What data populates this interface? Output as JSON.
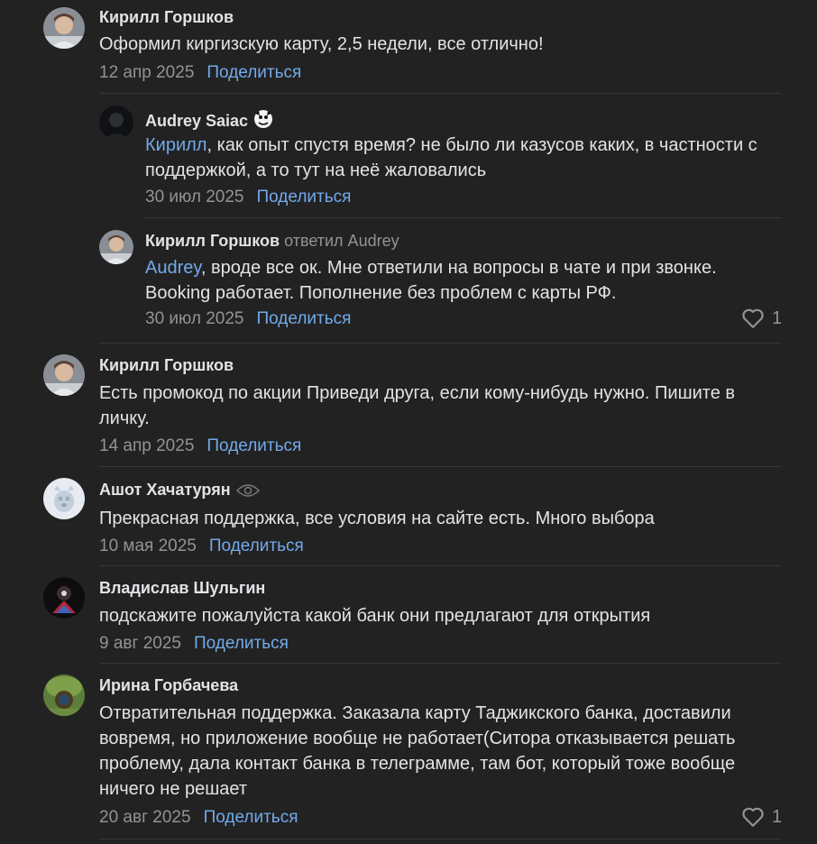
{
  "comments": [
    {
      "author": "Кирилл Горшков",
      "text": "Оформил киргизскую карту, 2,5 недели, все отлично!",
      "date": "12 апр 2025",
      "share": "Поделиться"
    },
    {
      "author": "Audrey Saiac",
      "mention": "Кирилл",
      "text": ", как опыт спустя время? не было ли казусов каких, в частности с поддержкой, а то тут на неё жаловались",
      "date": "30 июл 2025",
      "share": "Поделиться"
    },
    {
      "author": "Кирилл Горшков",
      "reply_to": "ответил Audrey",
      "mention": "Audrey",
      "text": ", вроде все ок. Мне ответили на вопросы в чате и при звонке. Booking работает. Пополнение без проблем с карты РФ.",
      "date": "30 июл 2025",
      "share": "Поделиться",
      "likes": "1"
    },
    {
      "author": "Кирилл Горшков",
      "text": "Есть промокод по акции Приведи друга, если кому-нибудь нужно. Пишите в личку.",
      "date": "14 апр 2025",
      "share": "Поделиться"
    },
    {
      "author": "Ашот Хачатурян",
      "text": "Прекрасная поддержка, все условия на сайте есть. Много выбора",
      "date": "10 мая 2025",
      "share": "Поделиться"
    },
    {
      "author": "Владислав Шульгин",
      "text": "подскажите пожалуйста какой банк они предлагают для открытия",
      "date": "9 авг 2025",
      "share": "Поделиться"
    },
    {
      "author": "Ирина Горбачева",
      "text": "Отвратительная поддержка. Заказала карту Таджикского банка, доставили вовремя, но приложение вообще не работает(Ситора отказывается решать проблему, дала контакт банка в телеграмме, там бот, который тоже вообще ничего не решает",
      "date": "20 авг 2025",
      "share": "Поделиться",
      "likes": "1"
    }
  ],
  "colors": {
    "background": "#222222",
    "text": "#e1e3e6",
    "secondary": "#939393",
    "accent": "#71aaeb",
    "divider": "#363738"
  }
}
